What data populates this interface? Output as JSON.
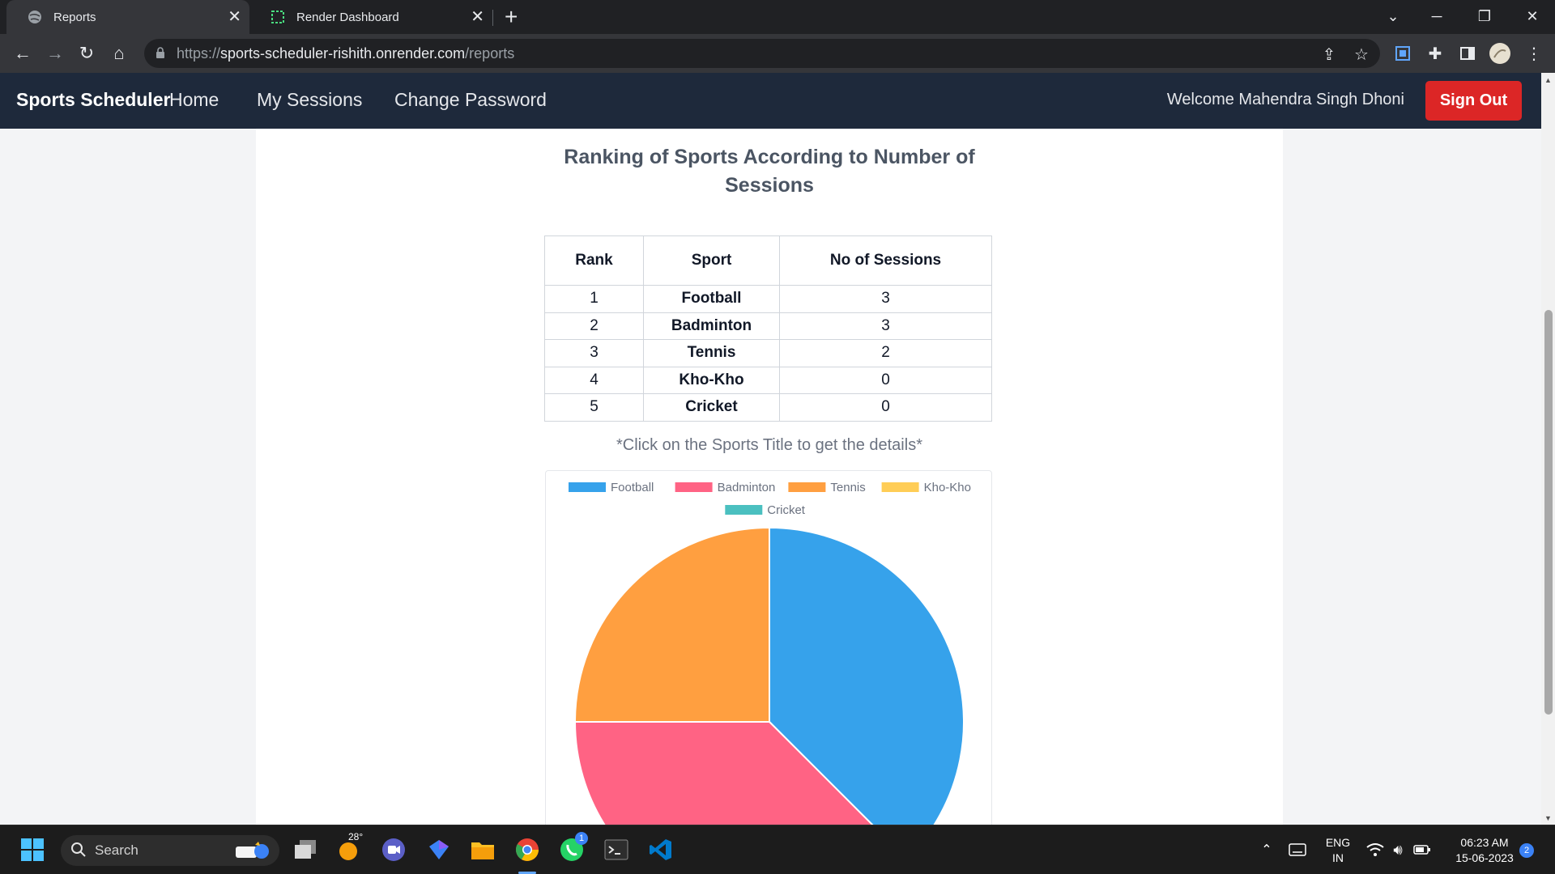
{
  "browser": {
    "tabs": [
      {
        "title": "Reports",
        "icon": "globe-icon",
        "active": true
      },
      {
        "title": "Render Dashboard",
        "icon": "render-icon",
        "active": false
      }
    ],
    "url_scheme": "https://",
    "url_host": "sports-scheduler-rishith.onrender.com",
    "url_path": "/reports"
  },
  "navbar": {
    "brand": "Sports Scheduler",
    "links": [
      "Home",
      "My Sessions",
      "Change Password"
    ],
    "welcome": "Welcome Mahendra Singh Dhoni",
    "signout": "Sign Out"
  },
  "report": {
    "title_line1": "Ranking of Sports According to Number of",
    "title_line2": "Sessions",
    "headers": [
      "Rank",
      "Sport",
      "No of Sessions"
    ],
    "rows": [
      {
        "rank": "1",
        "sport": "Football",
        "sessions": "3"
      },
      {
        "rank": "2",
        "sport": "Badminton",
        "sessions": "3"
      },
      {
        "rank": "3",
        "sport": "Tennis",
        "sessions": "2"
      },
      {
        "rank": "4",
        "sport": "Kho-Kho",
        "sessions": "0"
      },
      {
        "rank": "5",
        "sport": "Cricket",
        "sessions": "0"
      }
    ],
    "note": "*Click on the Sports Title to get the details*"
  },
  "chart_data": {
    "type": "pie",
    "categories": [
      "Football",
      "Badminton",
      "Tennis",
      "Kho-Kho",
      "Cricket"
    ],
    "values": [
      3,
      3,
      2,
      0,
      0
    ],
    "colors": [
      "#36a2eb",
      "#ff6384",
      "#ff9f40",
      "#ffcd56",
      "#4bc0c0"
    ],
    "legend_position": "top"
  },
  "taskbar": {
    "search_label": "Search",
    "weather_temp": "28°",
    "whatsapp_badge": "1",
    "lang_line1": "ENG",
    "lang_line2": "IN",
    "time": "06:23 AM",
    "date": "15-06-2023",
    "notification_count": "2"
  }
}
